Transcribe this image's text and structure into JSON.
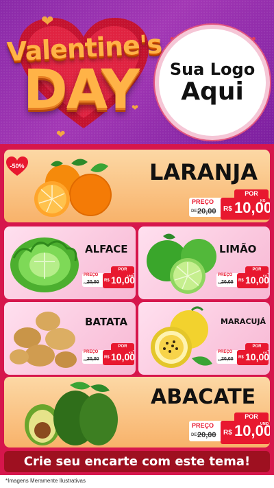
{
  "header": {
    "title_line1": "Valentine's",
    "title_line2": "DAY",
    "logo_line1": "Sua Logo",
    "logo_line2": "Aqui"
  },
  "badge": "-50%",
  "products": [
    {
      "name": "LARANJA",
      "por": "POR",
      "preco": "PREÇO",
      "de": "DE",
      "old": "20,00",
      "currency": "R$",
      "price": "10,00",
      "unit": "KG"
    },
    {
      "name": "ALFACE",
      "por": "POR",
      "preco": "PREÇO",
      "de": "DE",
      "old": "20,00",
      "currency": "R$",
      "price": "10,00",
      "unit": "UNID"
    },
    {
      "name": "LIMÃO",
      "por": "POR",
      "preco": "PREÇO",
      "de": "DE",
      "old": "20,00",
      "currency": "R$",
      "price": "10,00",
      "unit": "KG"
    },
    {
      "name": "BATATA",
      "por": "POR",
      "preco": "PREÇO",
      "de": "DE",
      "old": "20,00",
      "currency": "R$",
      "price": "10,00",
      "unit": "KG"
    },
    {
      "name": "MARACUJÁ",
      "por": "POR",
      "preco": "PREÇO",
      "de": "DE",
      "old": "20,00",
      "currency": "R$",
      "price": "10,00",
      "unit": "KG"
    },
    {
      "name": "ABACATE",
      "por": "POR",
      "preco": "PREÇO",
      "de": "DE",
      "old": "20,00",
      "currency": "R$",
      "price": "10,00",
      "unit": "UNID"
    }
  ],
  "cta": "Crie seu encarte com este tema!",
  "footer": "*Imagens Meramente Ilustrativas",
  "colors": {
    "accent": "#e8182f",
    "background": "#d6164c",
    "header": "#8a2aa8"
  },
  "icons": [
    "heart-icon",
    "orange-image",
    "lettuce-image",
    "lime-image",
    "potato-image",
    "passion-fruit-image",
    "avocado-image"
  ]
}
